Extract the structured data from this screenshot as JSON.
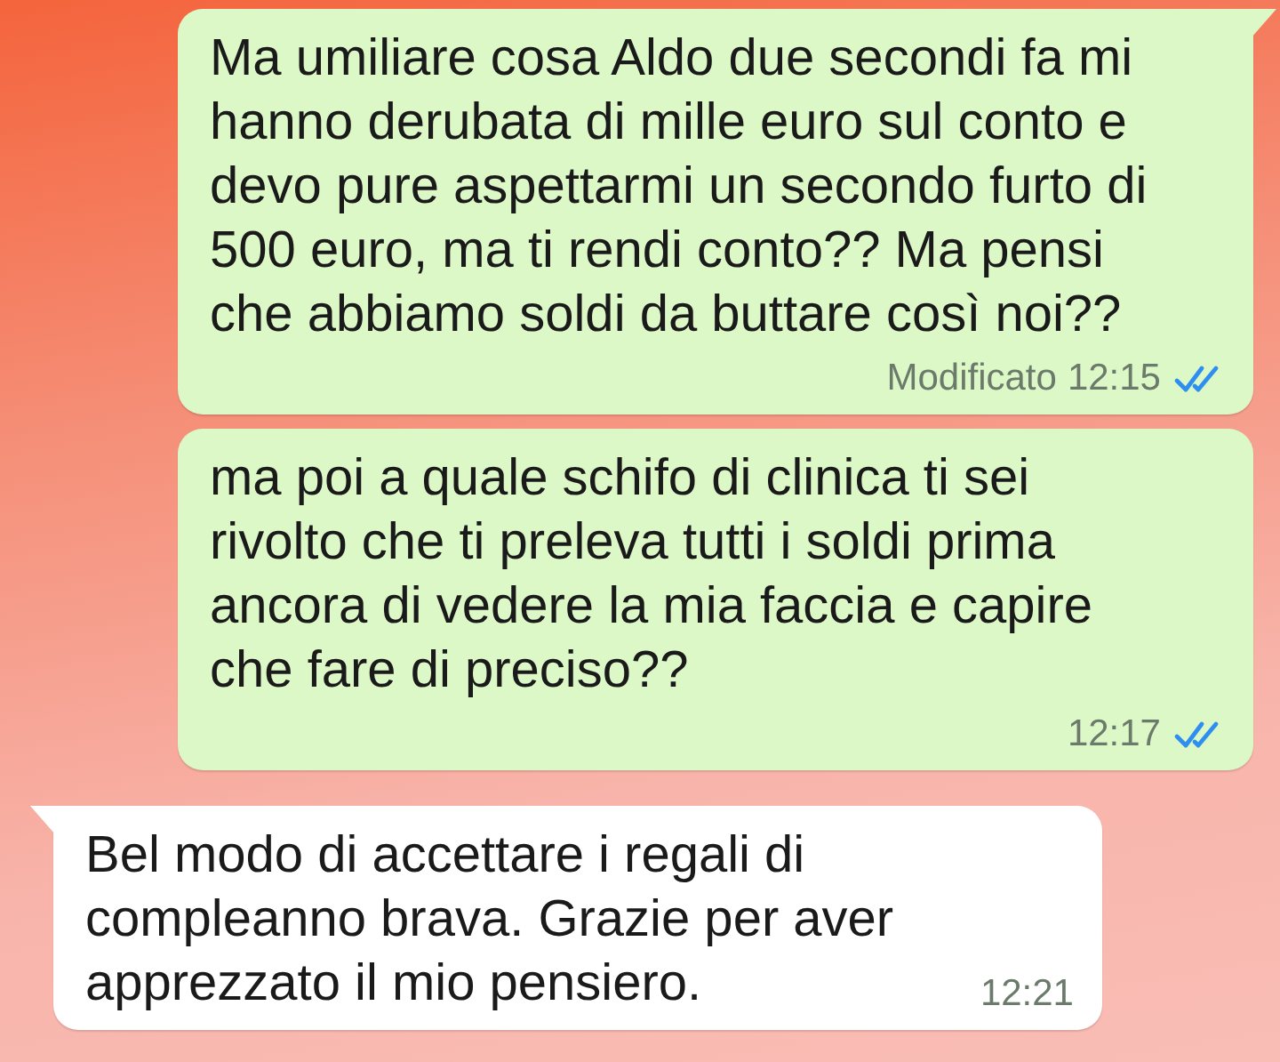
{
  "messages": [
    {
      "kind": "outgoing",
      "lines": [
        "Ma umiliare cosa Aldo due secondi fa mi",
        "hanno derubata di mille euro sul conto e",
        "devo pure aspettarmi un secondo furto di",
        "500 euro, ma ti rendi conto?? Ma pensi",
        "che abbiamo soldi da buttare così noi??"
      ],
      "edited_label": "Modificato",
      "time": "12:15",
      "read": true,
      "tail": true
    },
    {
      "kind": "outgoing",
      "lines": [
        "ma poi a quale schifo di clinica ti sei",
        "rivolto che ti preleva tutti i soldi prima",
        "ancora di vedere la mia faccia e capire",
        "che fare di preciso??"
      ],
      "time": "12:17",
      "read": true,
      "tail": false
    },
    {
      "kind": "incoming",
      "lines": [
        "Bel modo di accettare i regali di",
        "compleanno brava. Grazie per aver",
        "apprezzato il mio pensiero."
      ],
      "time": "12:21",
      "tail": true
    }
  ]
}
